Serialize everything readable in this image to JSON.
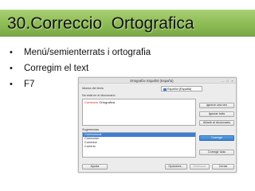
{
  "slide": {
    "title": "30.Correccio  Ortografica",
    "bullet_glyph": "•",
    "bullets": [
      "Menú/semienterrats i ortografia",
      "Corregim el text",
      "F7"
    ]
  },
  "dialog": {
    "title": "Ortografía: Español (España)",
    "controls": {
      "minimize": "–",
      "maximize": "□",
      "close": "×"
    },
    "language_label": "Idioma del texto",
    "language_value": "Español (España)",
    "not_in_dictionary_label": "No está en el diccionario",
    "text_error": "Correccio",
    "text_rest": " Ortografica",
    "suggestions_label": "Sugerencias",
    "suggestions": [
      "Correccional",
      "Corrección",
      "Corrector",
      "Correrlo"
    ],
    "selected_suggestion_index": 0,
    "buttons": {
      "ignore_once": "Ignorar una vez",
      "ignore_all": "Ignorar todo",
      "add_dictionary": "Añadir al diccionario",
      "correct": "Corregir",
      "correct_all": "Corregir todo",
      "help": "Ayuda",
      "options": "Opciones...",
      "undo": "Deshacer",
      "close": "Cerrar"
    }
  },
  "colors": {
    "title_bar": "#8dbb55",
    "error_text": "#d21e1e",
    "accent_blue": "#3b7fd4"
  }
}
